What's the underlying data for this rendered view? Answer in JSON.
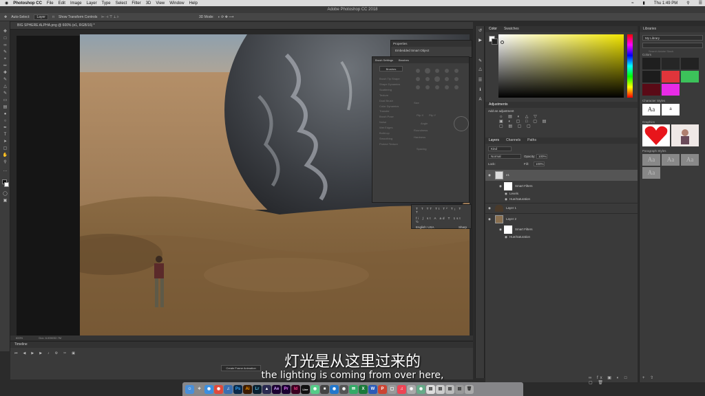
{
  "menubar": {
    "apple": "",
    "app": "Photoshop CC",
    "items": [
      "File",
      "Edit",
      "Image",
      "Layer",
      "Type",
      "Select",
      "Filter",
      "3D",
      "View",
      "Window",
      "Help"
    ],
    "clock": "Thu 1:49 PM"
  },
  "window_title": "Adobe Photoshop CC 2018",
  "options": {
    "auto_select_label": "Auto-Select:",
    "auto_select_value": "Layer",
    "transform_label": "Show Transform Controls",
    "mode_label": "3D Mode:"
  },
  "document": {
    "tab": "BIG SPHERE ALPHA.png @ 600% (e1, RGB/16) *",
    "zoom": "600%",
    "doc_size": "Doc: 6.00M/32.7M"
  },
  "timeline": {
    "title": "Timeline",
    "create_button": "Create Frame Animation"
  },
  "properties": {
    "title": "Properties",
    "subtitle": "Embedded Smart Object"
  },
  "brush_settings": {
    "tabs": [
      "Brush Settings",
      "Brushes"
    ],
    "brushes_button": "Brushes",
    "options": [
      "Brush Tip Shape",
      "Shape Dynamics",
      "Scattering",
      "Texture",
      "Dual Brush",
      "Color Dynamics",
      "Transfer",
      "Brush Pose",
      "Noise",
      "Wet Edges",
      "Build-up",
      "Smoothing",
      "Protect Texture"
    ],
    "labels": [
      "Size",
      "Flip X",
      "Flip Y",
      "Angle",
      "Roundness",
      "Hardness",
      "Spacing"
    ]
  },
  "character_mini": {
    "language": "English: USA",
    "aa": "Sharp"
  },
  "color_panel": {
    "tabs": [
      "Color",
      "Swatches"
    ],
    "hue_color": "#f2e600"
  },
  "adjustments": {
    "title": "Adjustments",
    "subtitle": "Add an adjustment"
  },
  "layers_panel": {
    "tabs": [
      "Layers",
      "Channels",
      "Paths"
    ],
    "kind": "Kind",
    "blend": "Normal",
    "opacity_label": "Opacity:",
    "opacity": "100%",
    "lock_label": "Lock:",
    "fill_label": "Fill:",
    "fill": "100%",
    "layers": [
      {
        "name": "e1",
        "kind": "smart"
      },
      {
        "name": "Smart Filters",
        "kind": "filter-group"
      },
      {
        "name": "Levels",
        "kind": "filter"
      },
      {
        "name": "Hue/Saturation",
        "kind": "filter"
      },
      {
        "name": "Layer 1",
        "kind": "layer"
      },
      {
        "name": "Layer 2",
        "kind": "smart"
      },
      {
        "name": "Smart Filters",
        "kind": "filter-group"
      },
      {
        "name": "Hue/Saturation",
        "kind": "filter"
      }
    ]
  },
  "libraries": {
    "title": "Libraries",
    "library": "My Library",
    "search_placeholder": "Search Adobe Stock",
    "sections": [
      "Colors",
      "Character Styles",
      "Graphics",
      "Paragraph Styles"
    ],
    "colors": [
      "#1f1f1f",
      "#262626",
      "#222222",
      "#1c1c1c",
      "#e0353b",
      "#3cc25a",
      "#5a0a16",
      "#e82be6"
    ],
    "char_styles": [
      "Aa",
      "a"
    ],
    "para_styles": [
      "Aa",
      "Aa",
      "Aa",
      "Aa"
    ]
  },
  "subtitles": {
    "zh": "灯光是从这里过来的",
    "en": "the lighting is coming from over here,"
  }
}
